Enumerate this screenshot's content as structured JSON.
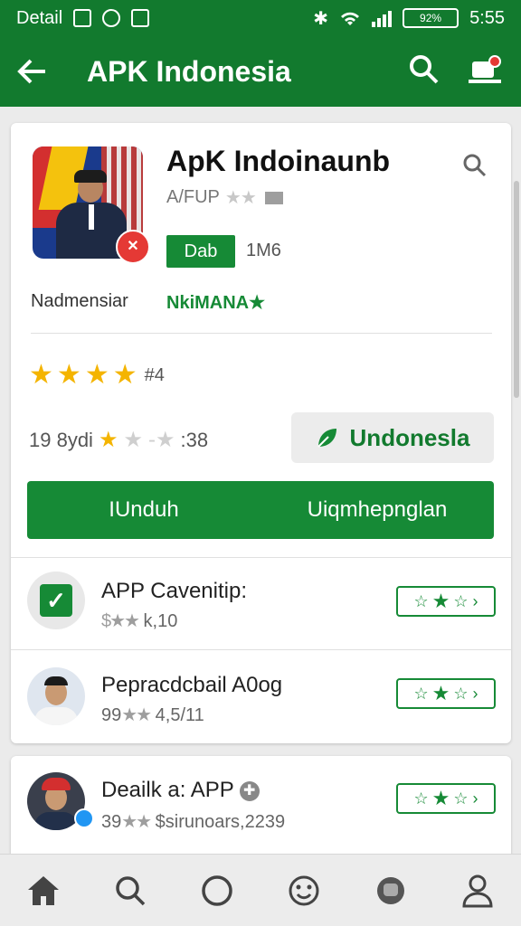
{
  "status_bar": {
    "left_label": "Detail",
    "battery": "92%",
    "time": "5:55"
  },
  "app_bar": {
    "title": "APK Indonesia"
  },
  "app": {
    "name": "ApK Indoinaunb",
    "developer": "A/FUP",
    "install_label": "Dab",
    "size": "1M6",
    "country": "Nadmensiar",
    "category": "NkiMANA★",
    "rating_value": "#4",
    "reviews_count": "19 8ydi",
    "reviews_score": ":38",
    "update_button": "Undonesla"
  },
  "actions": {
    "download": "IUnduh",
    "other": "Uiqmhepnglan"
  },
  "list": [
    {
      "title": "APP Cavenitip:",
      "subtitle": "k,10"
    },
    {
      "title": "Pepracdcbail A0og",
      "subtitle": "99",
      "subtitle_extra": "4,5/11"
    },
    {
      "title": "Deailk a: APP",
      "subtitle": "39",
      "subtitle_extra": "$sirunoars,2239"
    }
  ]
}
